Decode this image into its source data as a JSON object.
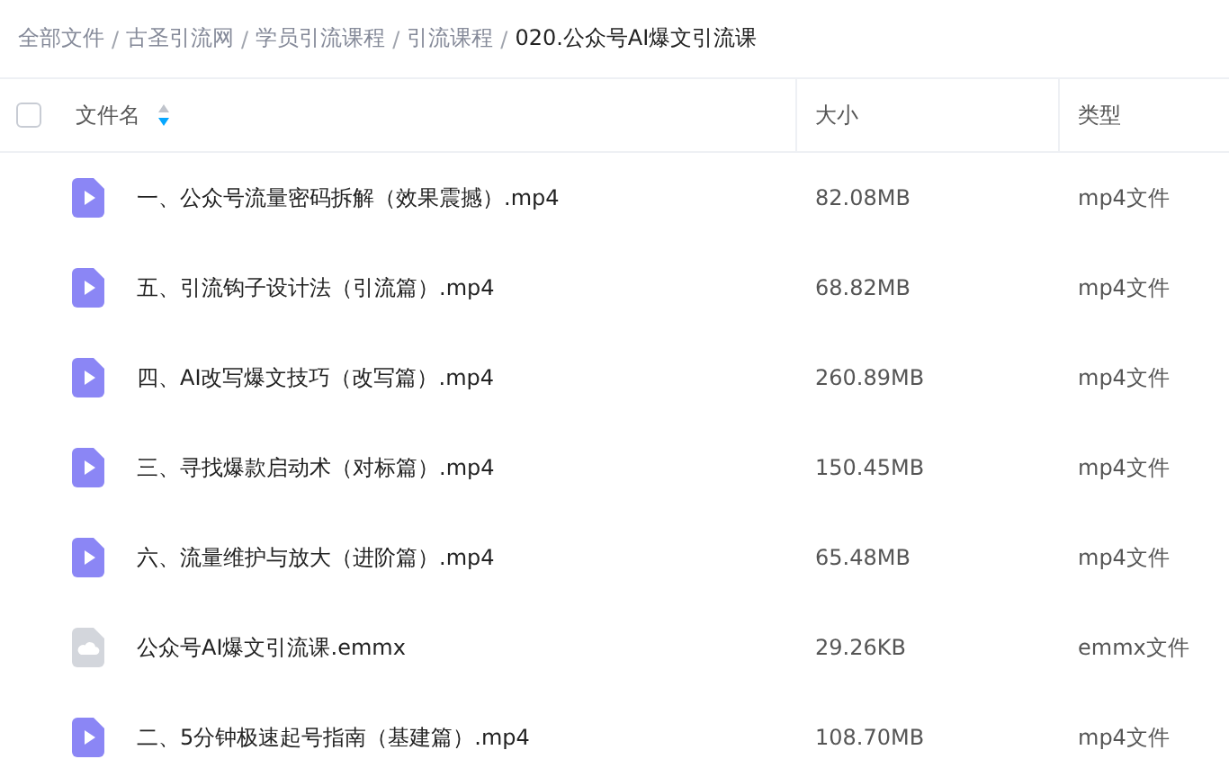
{
  "breadcrumb": [
    {
      "label": "全部文件",
      "current": false
    },
    {
      "label": "古圣引流网",
      "current": false
    },
    {
      "label": "学员引流课程",
      "current": false
    },
    {
      "label": "引流课程",
      "current": false
    },
    {
      "label": "020.公众号AI爆文引流课",
      "current": true
    }
  ],
  "breadcrumb_separator": "/",
  "table": {
    "select_all": {
      "checked": false
    },
    "columns": [
      {
        "label": "文件名",
        "sorted_descending": true
      },
      {
        "label": "大小"
      },
      {
        "label": "类型"
      }
    ],
    "rows": [
      {
        "kind": "video",
        "name": "一、公众号流量密码拆解（效果震撼）.mp4",
        "size": "82.08MB",
        "type": "mp4文件"
      },
      {
        "kind": "video",
        "name": "五、引流钩子设计法（引流篇）.mp4",
        "size": "68.82MB",
        "type": "mp4文件"
      },
      {
        "kind": "video",
        "name": "四、AI改写爆文技巧（改写篇）.mp4",
        "size": "260.89MB",
        "type": "mp4文件"
      },
      {
        "kind": "video",
        "name": "三、寻找爆款启动术（对标篇）.mp4",
        "size": "150.45MB",
        "type": "mp4文件"
      },
      {
        "kind": "video",
        "name": "六、流量维护与放大（进阶篇）.mp4",
        "size": "65.48MB",
        "type": "mp4文件"
      },
      {
        "kind": "mindmap",
        "name": "公众号AI爆文引流课.emmx",
        "size": "29.26KB",
        "type": "emmx文件"
      },
      {
        "kind": "video",
        "name": "二、5分钟极速起号指南（基建篇）.mp4",
        "size": "108.70MB",
        "type": "mp4文件"
      }
    ]
  }
}
